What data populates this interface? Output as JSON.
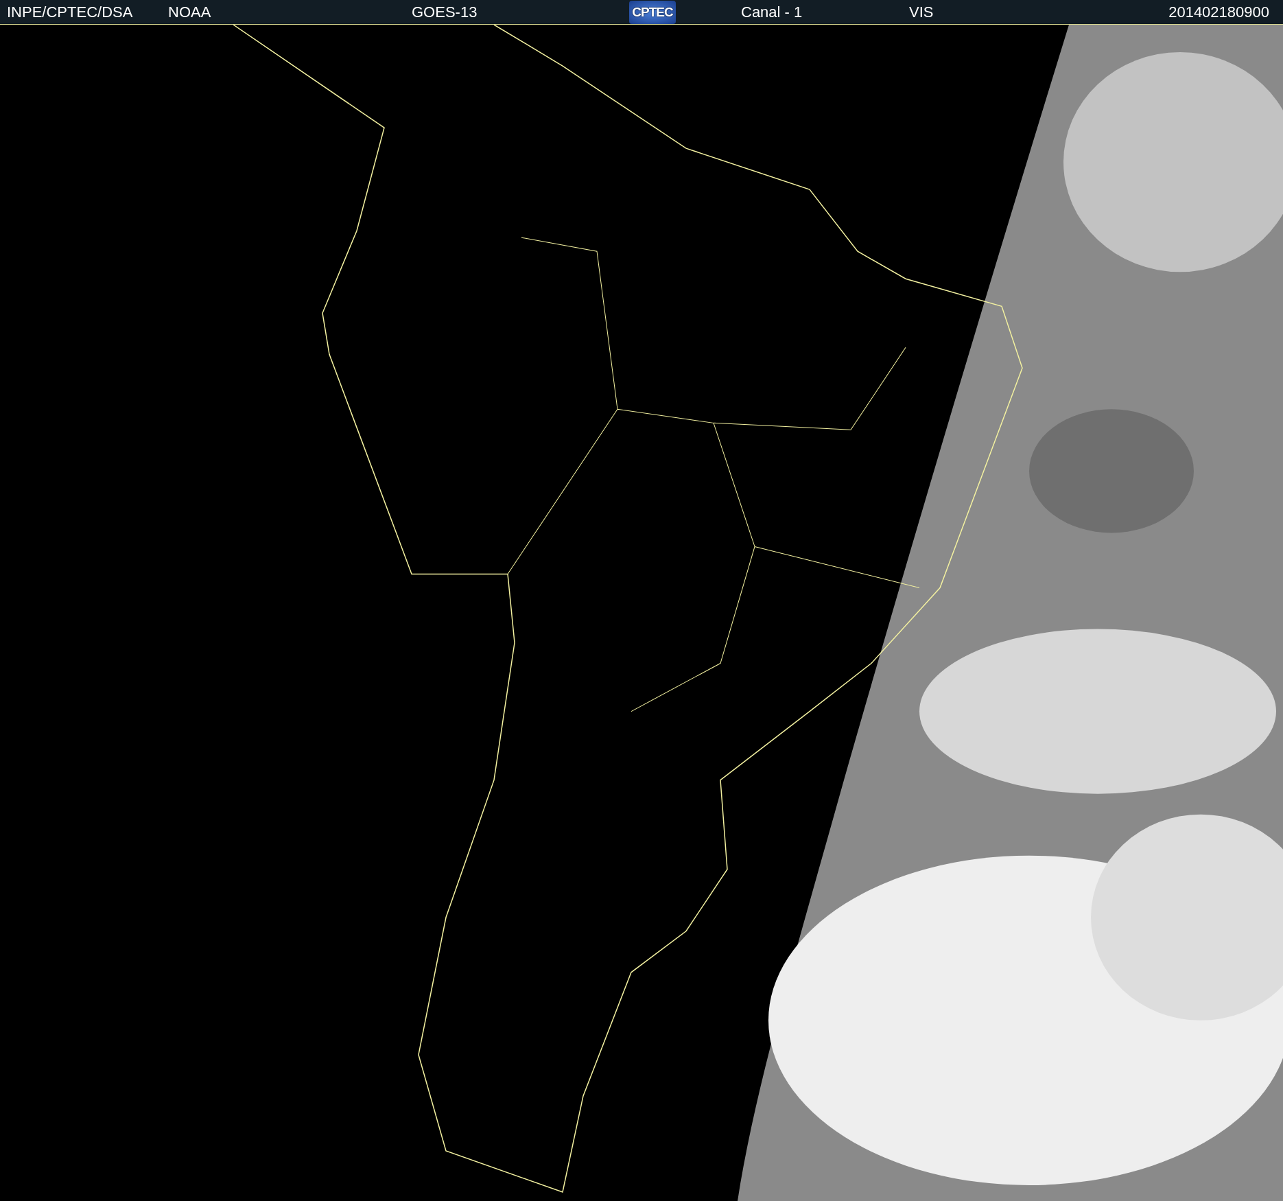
{
  "header": {
    "items": [
      {
        "kind": "text",
        "text": "INPE/CPTEC/DSA"
      },
      {
        "kind": "text",
        "text": "NOAA"
      },
      {
        "kind": "text",
        "text": "GOES-13"
      },
      {
        "kind": "logo",
        "text": "CPTEC"
      },
      {
        "kind": "text",
        "text": "Canal - 1"
      },
      {
        "kind": "text",
        "text": "VIS"
      },
      {
        "kind": "text",
        "text": "201402180900"
      }
    ]
  }
}
